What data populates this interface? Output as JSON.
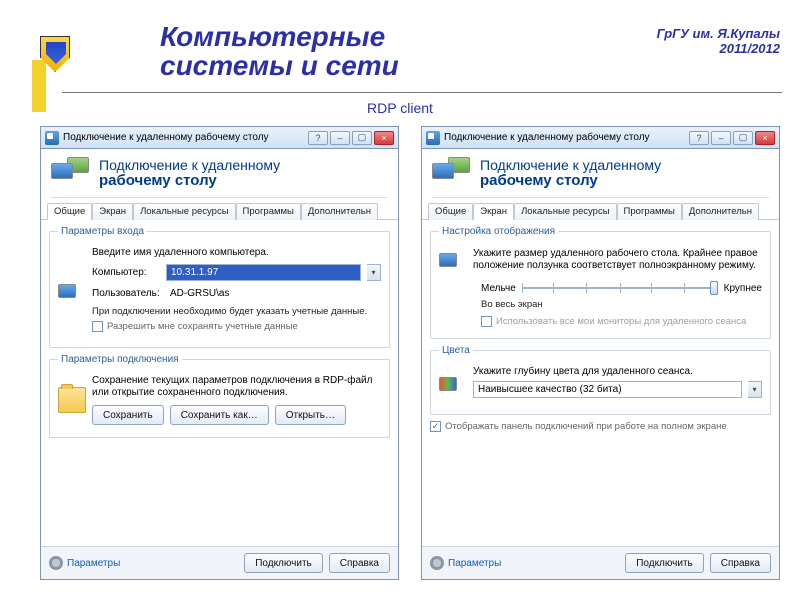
{
  "header": {
    "title_line1": "Компьютерные",
    "title_line2": "системы и сети",
    "org": "ГрГУ им. Я.Купалы",
    "year": "2011/2012",
    "subtitle": "RDP client"
  },
  "window_title": "Подключение к удаленному рабочему столу",
  "winbtns": {
    "help": "?",
    "min": "–",
    "max": "▢",
    "close": "×"
  },
  "banner": {
    "line1": "Подключение к удаленному",
    "line2": "рабочему столу"
  },
  "tabs": [
    "Общие",
    "Экран",
    "Локальные ресурсы",
    "Программы",
    "Дополнительн"
  ],
  "left": {
    "active_tab": 0,
    "login_group": "Параметры входа",
    "instr": "Введите имя удаленного компьютера.",
    "computer_label": "Компьютер:",
    "computer_value": "10.31.1.97",
    "user_label": "Пользователь:",
    "user_value": "AD-GRSU\\as",
    "cred_note": "При подключении необходимо будет указать учетные данные.",
    "remember_chk": "Разрешить мне сохранять учетные данные",
    "conn_group": "Параметры подключения",
    "conn_text": "Сохранение текущих параметров подключения в RDP-файл или открытие сохраненного подключения.",
    "btn_save": "Сохранить",
    "btn_saveas": "Сохранить как…",
    "btn_open": "Открыть…"
  },
  "right": {
    "active_tab": 1,
    "disp_group": "Настройка отображения",
    "disp_text": "Укажите размер удаленного рабочего стола. Крайнее правое положение ползунка соответствует полноэкранному режиму.",
    "slider_left": "Мельче",
    "slider_right": "Крупнее",
    "fullscreen_text": "Во весь экран",
    "allmon_chk": "Использовать все мои мониторы для удаленного сеанса",
    "color_group": "Цвета",
    "color_text": "Укажите глубину цвета для удаленного сеанса.",
    "color_value": "Наивысшее качество (32 бита)",
    "show_bar_chk": "Отображать панель подключений при работе на полном экране"
  },
  "footer": {
    "options": "Параметры",
    "connect": "Подключить",
    "help": "Справка"
  }
}
